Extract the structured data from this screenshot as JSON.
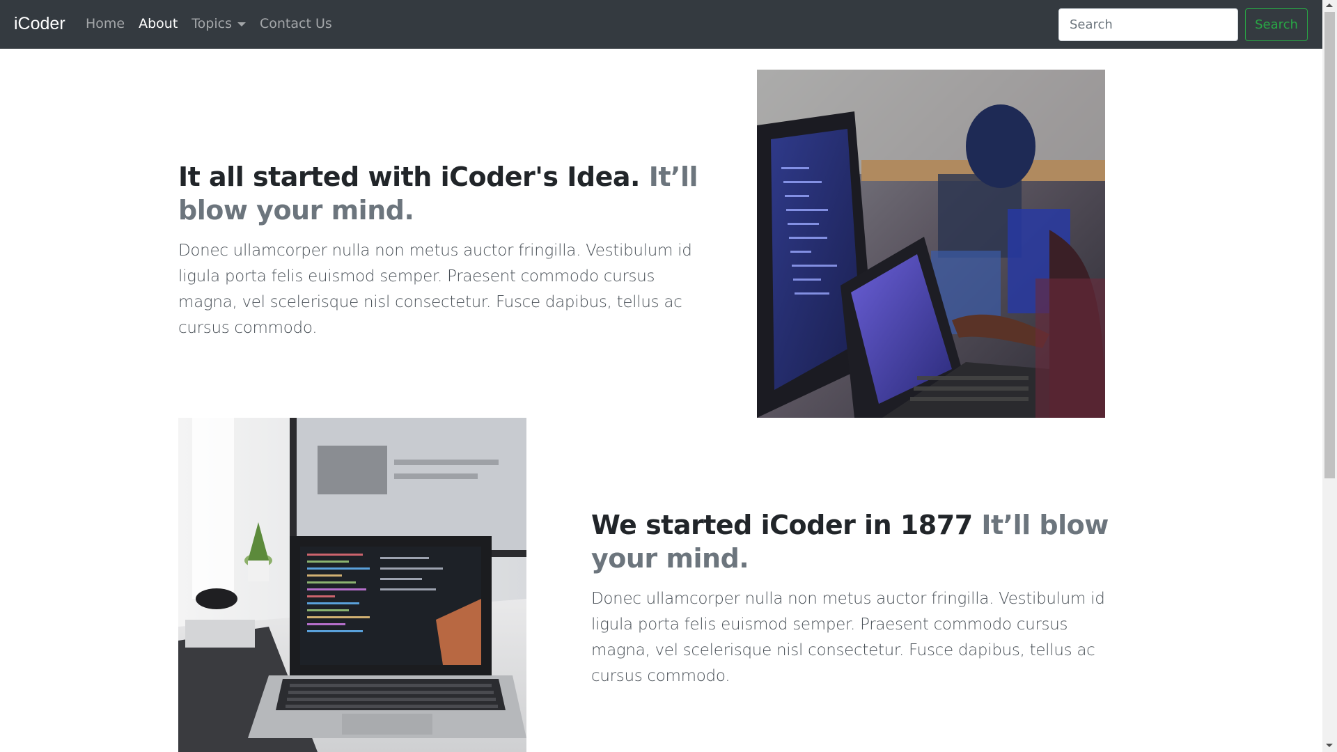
{
  "navbar": {
    "brand": "iCoder",
    "links": [
      {
        "label": "Home",
        "active": false
      },
      {
        "label": "About",
        "active": true
      },
      {
        "label": "Topics",
        "active": false,
        "dropdown": true
      },
      {
        "label": "Contact Us",
        "active": false
      }
    ],
    "search": {
      "placeholder": "Search",
      "value": "",
      "button_label": "Search"
    }
  },
  "features": [
    {
      "heading": "It all started with iCoder's Idea.",
      "heading_muted": "It’ll blow your mind.",
      "lead": "Donec ullamcorper nulla non metus auctor fringilla. Vestibulum id ligula porta felis euismod semper. Praesent commodo cursus magna, vel scelerisque nisl consectetur. Fusce dapibus, tellus ac cursus commodo.",
      "image": "office-coders-laptops-photo"
    },
    {
      "heading": "We started iCoder in 1877",
      "heading_muted": "It’ll blow your mind.",
      "lead": "Donec ullamcorper nulla non metus auctor fringilla. Vestibulum id ligula porta felis euismod semper. Praesent commodo cursus magna, vel scelerisque nisl consectetur. Fusce dapibus, tellus ac cursus commodo.",
      "image": "macbook-code-desk-photo"
    }
  ],
  "colors": {
    "navbar_bg": "#343a40",
    "success": "#28a745",
    "muted": "#6c757d"
  }
}
